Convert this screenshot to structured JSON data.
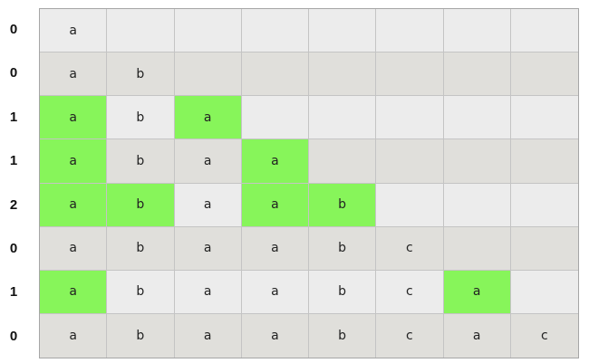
{
  "colors": {
    "row_odd": "#ececec",
    "row_even": "#e0dfdb",
    "highlight": "#87f55a"
  },
  "row_values": [
    "0",
    "0",
    "1",
    "1",
    "2",
    "0",
    "1",
    "0"
  ],
  "rows": [
    [
      "a",
      "",
      "",
      "",
      "",
      "",
      "",
      ""
    ],
    [
      "a",
      "b",
      "",
      "",
      "",
      "",
      "",
      ""
    ],
    [
      "a",
      "b",
      "a",
      "",
      "",
      "",
      "",
      ""
    ],
    [
      "a",
      "b",
      "a",
      "a",
      "",
      "",
      "",
      ""
    ],
    [
      "a",
      "b",
      "a",
      "a",
      "b",
      "",
      "",
      ""
    ],
    [
      "a",
      "b",
      "a",
      "a",
      "b",
      "c",
      "",
      ""
    ],
    [
      "a",
      "b",
      "a",
      "a",
      "b",
      "c",
      "a",
      ""
    ],
    [
      "a",
      "b",
      "a",
      "a",
      "b",
      "c",
      "a",
      "c"
    ]
  ],
  "highlighted": [
    [
      2,
      0
    ],
    [
      2,
      2
    ],
    [
      3,
      0
    ],
    [
      3,
      3
    ],
    [
      4,
      0
    ],
    [
      4,
      1
    ],
    [
      4,
      3
    ],
    [
      4,
      4
    ],
    [
      6,
      0
    ],
    [
      6,
      6
    ]
  ]
}
